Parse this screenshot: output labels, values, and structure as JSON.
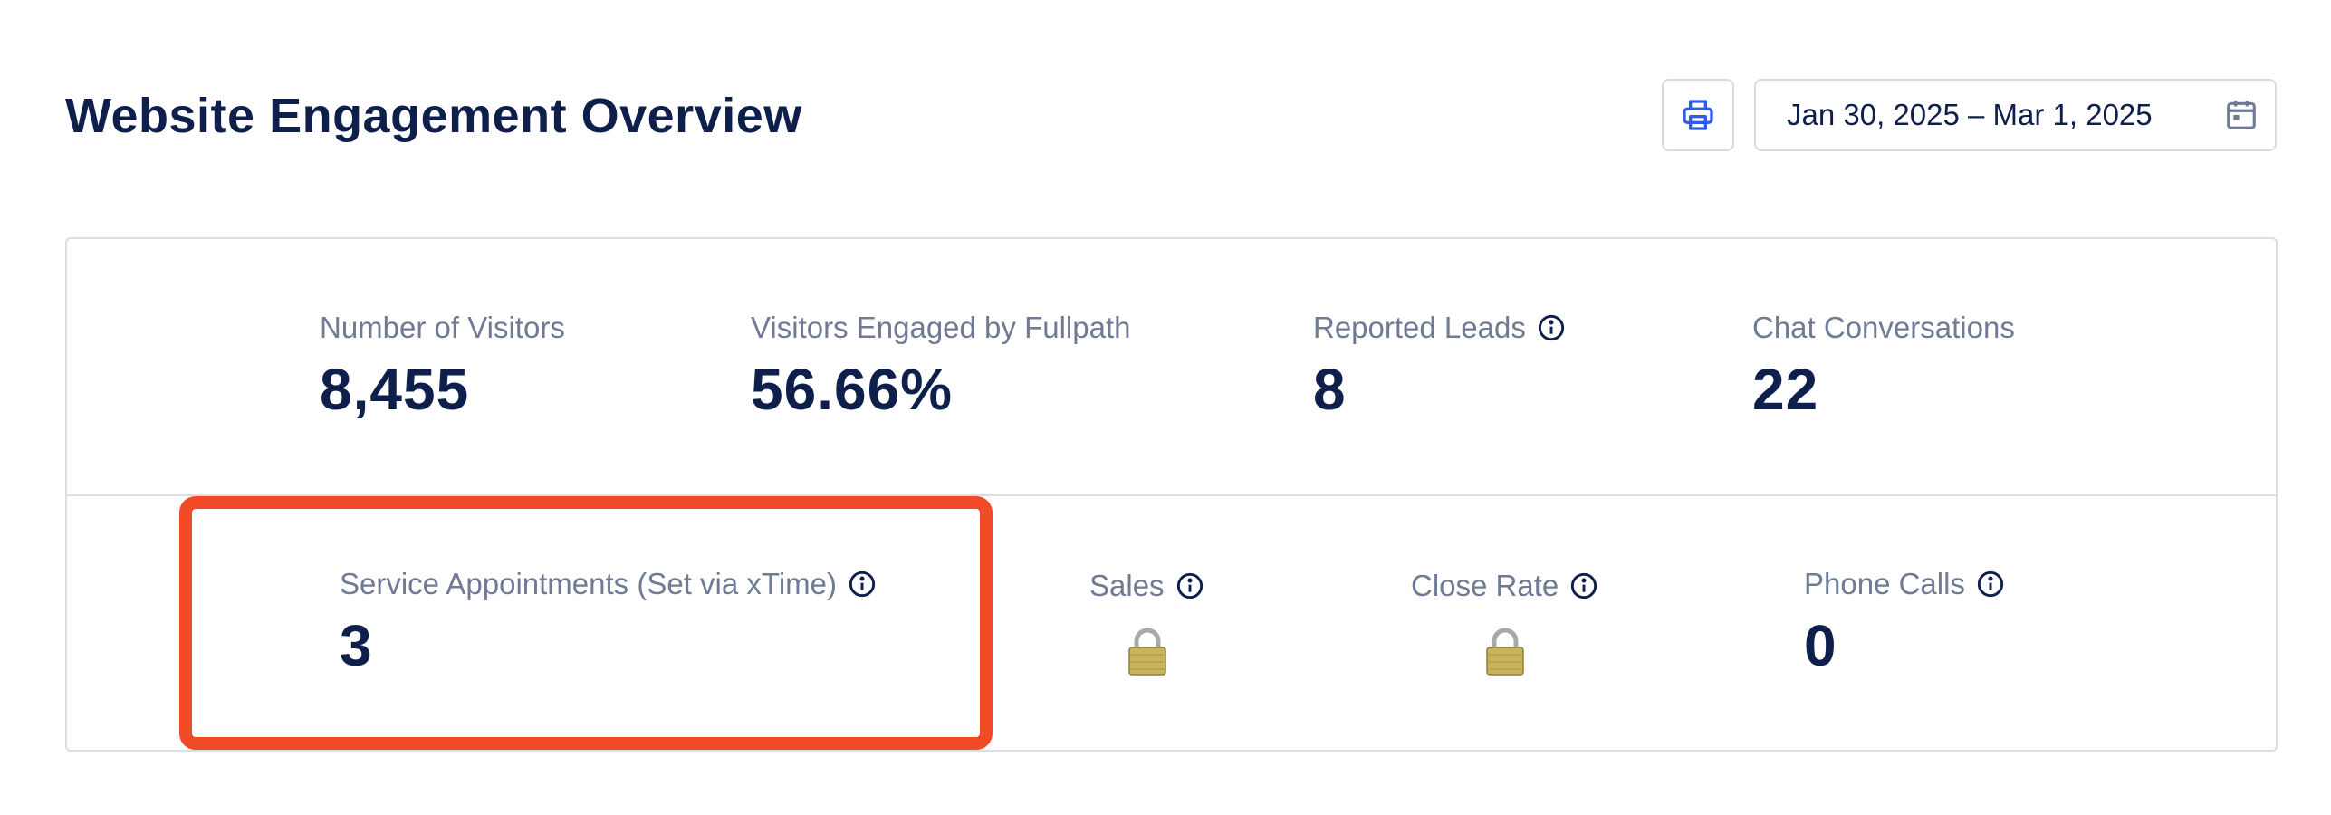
{
  "header": {
    "title": "Website Engagement Overview",
    "print_icon": "printer-icon",
    "date_range": "Jan 30, 2025 – Mar 1, 2025",
    "calendar_icon": "calendar-icon"
  },
  "metrics_top": [
    {
      "label": "Number of Visitors",
      "value": "8,455",
      "has_info": false
    },
    {
      "label": "Visitors Engaged by Fullpath",
      "value": "56.66%",
      "has_info": false
    },
    {
      "label": "Reported Leads",
      "value": "8",
      "has_info": true
    },
    {
      "label": "Chat Conversations",
      "value": "22",
      "has_info": false
    }
  ],
  "metrics_bottom": [
    {
      "label": "Service Appointments (Set via xTime)",
      "value": "3",
      "has_info": true,
      "locked": false
    },
    {
      "label": "Sales",
      "value": "",
      "has_info": true,
      "locked": true
    },
    {
      "label": "Close Rate",
      "value": "",
      "has_info": true,
      "locked": true
    },
    {
      "label": "Phone Calls",
      "value": "0",
      "has_info": true,
      "locked": false
    }
  ],
  "colors": {
    "title": "#0f1f4b",
    "label": "#6f7b94",
    "accent": "#2f5bea",
    "highlight": "#f24a26",
    "border": "#dadde4"
  }
}
